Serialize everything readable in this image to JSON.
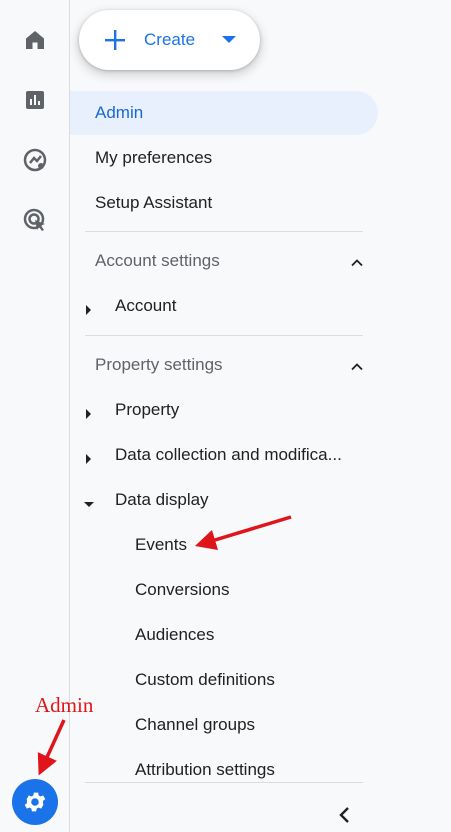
{
  "create": {
    "label": "Create"
  },
  "nav": {
    "admin": "Admin",
    "my_preferences": "My preferences",
    "setup_assistant": "Setup Assistant"
  },
  "account_settings": {
    "header": "Account settings",
    "items": [
      "Account"
    ]
  },
  "property_settings": {
    "header": "Property settings",
    "items": [
      "Property",
      "Data collection and modifica..."
    ],
    "expanded": {
      "label": "Data display",
      "children": [
        "Events",
        "Conversions",
        "Audiences",
        "Custom definitions",
        "Channel groups",
        "Attribution settings"
      ]
    }
  },
  "annotation": {
    "label": "Admin"
  },
  "icons": {
    "home": "home-icon",
    "reports": "reports-icon",
    "explore": "explore-icon",
    "advertising": "advertising-icon",
    "settings": "gear-icon",
    "collapse": "chevron-left-icon"
  },
  "colors": {
    "accent": "#1a73e8",
    "active_bg": "#e8f0fe",
    "annotation": "#e0151b"
  }
}
